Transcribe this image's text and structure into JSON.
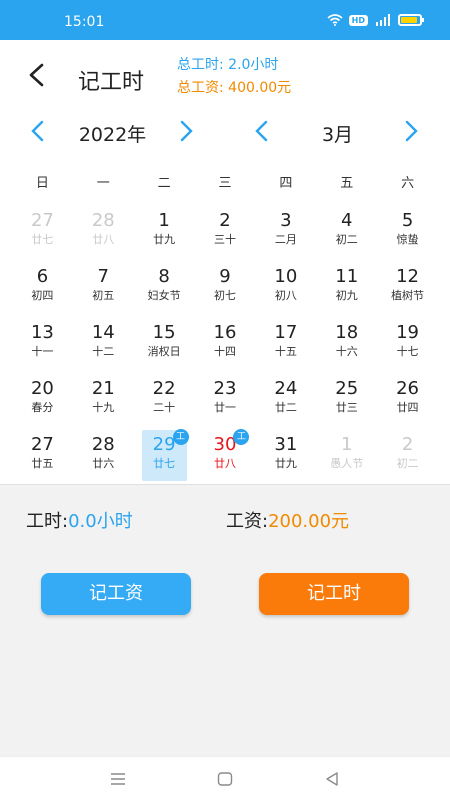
{
  "status": {
    "time": "15:01",
    "hd": "HD"
  },
  "header": {
    "title": "记工时",
    "total_hours": "总工时: 2.0小时",
    "total_wage": "总工资: 400.00元"
  },
  "nav": {
    "year": "2022年",
    "month": "3月"
  },
  "weekdays": [
    "日",
    "一",
    "二",
    "三",
    "四",
    "五",
    "六"
  ],
  "days": [
    {
      "num": "27",
      "lunar": "廿七",
      "state": "dim"
    },
    {
      "num": "28",
      "lunar": "廿八",
      "state": "dim"
    },
    {
      "num": "1",
      "lunar": "廿九"
    },
    {
      "num": "2",
      "lunar": "三十"
    },
    {
      "num": "3",
      "lunar": "二月"
    },
    {
      "num": "4",
      "lunar": "初二"
    },
    {
      "num": "5",
      "lunar": "惊蛰"
    },
    {
      "num": "6",
      "lunar": "初四"
    },
    {
      "num": "7",
      "lunar": "初五"
    },
    {
      "num": "8",
      "lunar": "妇女节"
    },
    {
      "num": "9",
      "lunar": "初七"
    },
    {
      "num": "10",
      "lunar": "初八"
    },
    {
      "num": "11",
      "lunar": "初九"
    },
    {
      "num": "12",
      "lunar": "植树节"
    },
    {
      "num": "13",
      "lunar": "十一"
    },
    {
      "num": "14",
      "lunar": "十二"
    },
    {
      "num": "15",
      "lunar": "消权日"
    },
    {
      "num": "16",
      "lunar": "十四"
    },
    {
      "num": "17",
      "lunar": "十五"
    },
    {
      "num": "18",
      "lunar": "十六"
    },
    {
      "num": "19",
      "lunar": "十七"
    },
    {
      "num": "20",
      "lunar": "春分"
    },
    {
      "num": "21",
      "lunar": "十九"
    },
    {
      "num": "22",
      "lunar": "二十"
    },
    {
      "num": "23",
      "lunar": "廿一"
    },
    {
      "num": "24",
      "lunar": "廿二"
    },
    {
      "num": "25",
      "lunar": "廿三"
    },
    {
      "num": "26",
      "lunar": "廿四"
    },
    {
      "num": "27",
      "lunar": "廿五"
    },
    {
      "num": "28",
      "lunar": "廿六"
    },
    {
      "num": "29",
      "lunar": "廿七",
      "state": "selected",
      "badge": "工"
    },
    {
      "num": "30",
      "lunar": "廿八",
      "state": "red",
      "badge": "工"
    },
    {
      "num": "31",
      "lunar": "廿九"
    },
    {
      "num": "1",
      "lunar": "愚人节",
      "state": "dim"
    },
    {
      "num": "2",
      "lunar": "初二",
      "state": "dim"
    }
  ],
  "stats": {
    "hours_label": "工时:",
    "hours_value": "0.0小时",
    "wage_label": "工资:",
    "wage_value": "200.00元"
  },
  "buttons": {
    "wage": "记工资",
    "hours": "记工时"
  },
  "colors": {
    "accent": "#2aa4ef",
    "orange": "#fa7a0a",
    "holiday_red": "#e8151b"
  }
}
